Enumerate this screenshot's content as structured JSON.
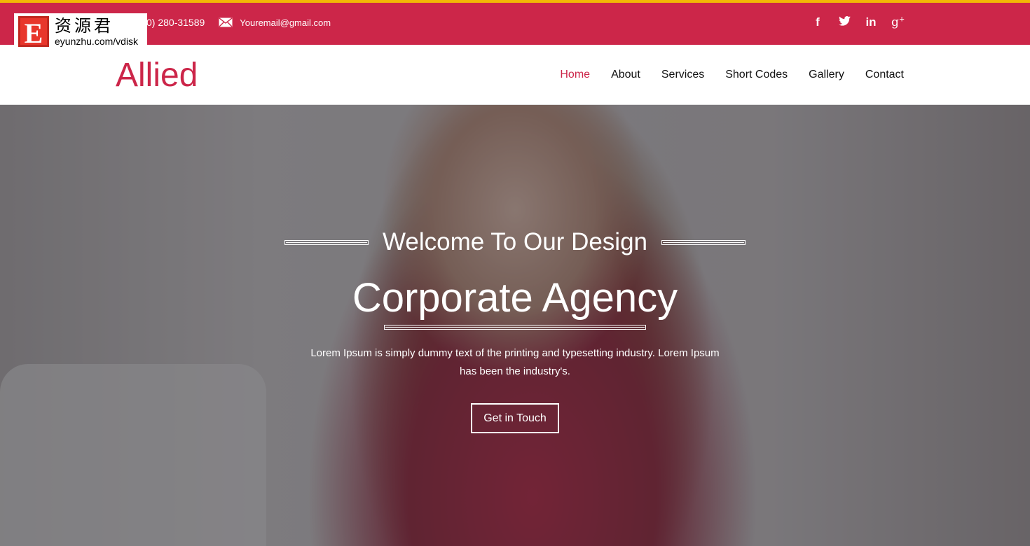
{
  "watermark": {
    "mark": "E",
    "chinese": "资源君",
    "url": "eyunzhu.com/vdisk"
  },
  "topbar": {
    "phone": "0) 280-31589",
    "email": "Youremail@gmail.com",
    "social": [
      {
        "icon": "facebook-icon",
        "glyph": "f"
      },
      {
        "icon": "twitter-icon",
        "glyph": "🐦"
      },
      {
        "icon": "linkedin-icon",
        "glyph": "in"
      },
      {
        "icon": "google-plus-icon",
        "glyph": "g+"
      }
    ]
  },
  "nav": {
    "brand": "Allied",
    "items": [
      "Home",
      "About",
      "Services",
      "Short Codes",
      "Gallery",
      "Contact"
    ],
    "active": "Home"
  },
  "hero": {
    "welcome": "Welcome To Our Design",
    "title": "Corporate Agency",
    "description": "Lorem Ipsum is simply dummy text of the printing and typesetting industry. Lorem Ipsum has been the industry's.",
    "button": "Get in Touch"
  },
  "colors": {
    "accent": "#cc2649",
    "top_line": "#f2b705"
  }
}
